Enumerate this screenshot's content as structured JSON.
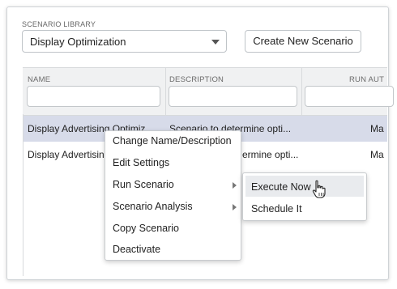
{
  "library": {
    "label": "SCENARIO LIBRARY",
    "selected": "Display Optimization",
    "create_button": "Create New Scenario"
  },
  "columns": [
    "NAME",
    "DESCRIPTION",
    "RUN AUT"
  ],
  "rows": [
    {
      "name": "Display Advertising Optimiz",
      "description": "Scenario to determine opti...",
      "run": "Ma"
    },
    {
      "name": "Display Advertisin",
      "description": "ermine opti...",
      "run": "Ma"
    }
  ],
  "context_menu": {
    "items": [
      {
        "label": "Change Name/Description"
      },
      {
        "label": "Edit Settings"
      },
      {
        "label": "Run Scenario"
      },
      {
        "label": "Scenario Analysis"
      },
      {
        "label": "Copy Scenario"
      },
      {
        "label": "Deactivate"
      }
    ]
  },
  "submenu": {
    "items": [
      {
        "label": "Execute Now"
      },
      {
        "label": "Schedule It"
      }
    ]
  },
  "colors": {
    "selected_row": "#d7dbe9",
    "hover_item": "#e9ebee"
  }
}
